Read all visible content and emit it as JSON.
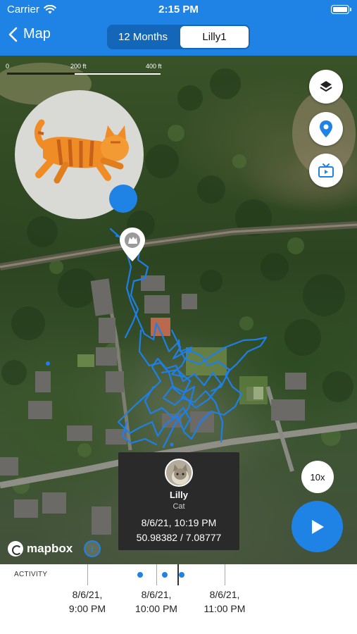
{
  "status": {
    "carrier": "Carrier",
    "time": "2:15 PM"
  },
  "nav": {
    "back_label": "Map",
    "segments": [
      "12 Months",
      "Lilly1"
    ],
    "selected_segment": "Lilly1"
  },
  "map": {
    "scale": {
      "labels": [
        "0",
        "200 ft",
        "400 ft"
      ]
    },
    "buttons": [
      "layers-icon",
      "location-pin-icon",
      "tv-play-icon"
    ],
    "attribution": "mapbox"
  },
  "info_card": {
    "name": "Lilly",
    "type": "Cat",
    "datetime": "8/6/21, 10:19 PM",
    "coordinates": "50.98382 / 7.08777"
  },
  "playback": {
    "speed": "10x"
  },
  "timeline": {
    "label": "ACTIVITY",
    "ticks": [
      {
        "date": "8/6/21,",
        "time": "9:00 PM"
      },
      {
        "date": "8/6/21,",
        "time": "10:00 PM"
      },
      {
        "date": "8/6/21,",
        "time": "11:00 PM"
      }
    ]
  },
  "colors": {
    "accent": "#1f83e6",
    "card": "#2a2a2a",
    "track": "#1e7fe8"
  }
}
